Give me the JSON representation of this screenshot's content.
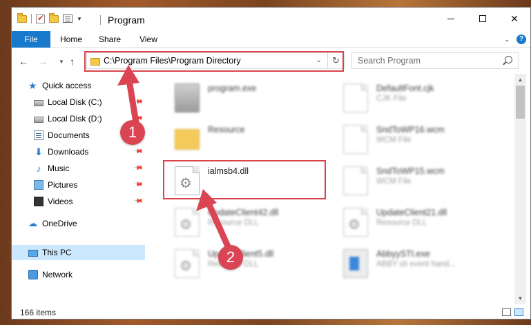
{
  "window": {
    "title": "Program"
  },
  "ribbon": {
    "tabs": [
      {
        "label": "File"
      },
      {
        "label": "Home"
      },
      {
        "label": "Share"
      },
      {
        "label": "View"
      }
    ]
  },
  "nav": {
    "address": "C:\\Program Files\\Program Directory",
    "search_placeholder": "Search Program"
  },
  "sidebar": {
    "items": [
      {
        "label": "Quick access",
        "icon": "star-icon"
      },
      {
        "label": "Local Disk (C:)",
        "icon": "drive-icon"
      },
      {
        "label": "Local Disk (D:)",
        "icon": "drive-icon"
      },
      {
        "label": "Documents",
        "icon": "documents-icon"
      },
      {
        "label": "Downloads",
        "icon": "download-icon"
      },
      {
        "label": "Music",
        "icon": "music-icon"
      },
      {
        "label": "Pictures",
        "icon": "pictures-icon"
      },
      {
        "label": "Videos",
        "icon": "videos-icon"
      },
      {
        "label": "OneDrive",
        "icon": "cloud-icon"
      },
      {
        "label": "This PC",
        "icon": "computer-icon"
      },
      {
        "label": "Network",
        "icon": "network-icon"
      }
    ]
  },
  "files": [
    {
      "name": "program.exe",
      "type": "",
      "icon": "exe-icon"
    },
    {
      "name": "DefaultFont.cjk",
      "type": "CJK File",
      "icon": "document-icon"
    },
    {
      "name": "Resource",
      "type": "",
      "icon": "folder-icon"
    },
    {
      "name": "SndToWP16.wcm",
      "type": "WCM File",
      "icon": "document-icon"
    },
    {
      "name": "ialmsb4.dll",
      "type": "",
      "icon": "dll-icon"
    },
    {
      "name": "SndToWP15.wcm",
      "type": "WCM File",
      "icon": "document-icon"
    },
    {
      "name": "UpdateClient42.dll",
      "type": "Resource DLL",
      "icon": "dll-icon"
    },
    {
      "name": "UpdateClient21.dll",
      "type": "Resource DLL",
      "icon": "dll-icon"
    },
    {
      "name": "UpdateClient5.dll",
      "type": "Resource DLL",
      "icon": "dll-icon"
    },
    {
      "name": "AbbyySTI.exe",
      "type": "ABBY sti event hand...",
      "icon": "app-icon"
    }
  ],
  "status": {
    "item_count": "166 items"
  },
  "callouts": {
    "step1": "1",
    "step2": "2"
  },
  "colors": {
    "accent": "#1979ca",
    "annotation": "#d9434e",
    "selection": "#cce8ff"
  }
}
